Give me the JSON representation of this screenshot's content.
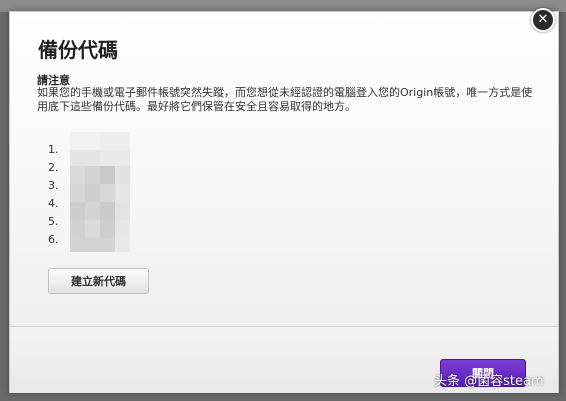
{
  "modal": {
    "title": "備份代碼",
    "notice_heading": "請注意",
    "notice_text": "如果您的手機或電子郵件帳號突然失蹤，而您想從未經認證的電腦登入您的Origin帳號，唯一方式是使用底下這些備份代碼。最好將它們保管在安全且容易取得的地方。",
    "codes": [
      "1.",
      "2.",
      "3.",
      "4.",
      "5.",
      "6."
    ],
    "new_code_button": "建立新代碼",
    "close_button": "關閉",
    "close_icon": "close-icon"
  },
  "watermark": "头条 @菌容steam"
}
